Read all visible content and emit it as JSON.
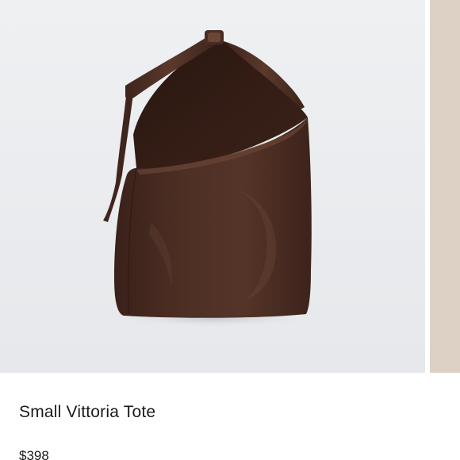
{
  "product": {
    "image_subject": "dark brown leather hobo tote bag",
    "title": "Small Vittoria Tote",
    "price": "$398"
  },
  "colors": {
    "image_background": "#e9ebee",
    "next_slide_background": "#ddd1c5",
    "bag_leather": "#4a2c22",
    "text": "#1a1a1a"
  }
}
